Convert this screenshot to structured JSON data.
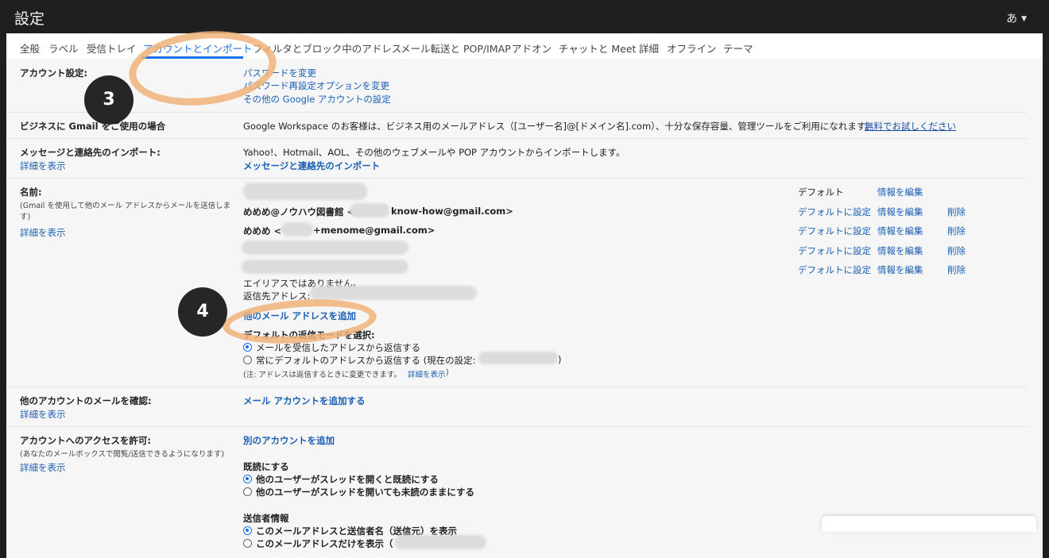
{
  "window": {
    "title": "設定",
    "ime_indicator": "あ"
  },
  "tabs": [
    {
      "label": "全般"
    },
    {
      "label": "ラベル"
    },
    {
      "label": "受信トレイ"
    },
    {
      "label": "アカウントとインポート",
      "active": true
    },
    {
      "label": "フィルタとブロック中のアドレス"
    },
    {
      "label": "メール転送と POP/IMAP"
    },
    {
      "label": "アドオン"
    },
    {
      "label": "チャットと Meet"
    },
    {
      "label": "詳細"
    },
    {
      "label": "オフライン"
    },
    {
      "label": "テーマ"
    }
  ],
  "account_settings": {
    "label": "アカウント設定:",
    "links": [
      "パスワードを変更",
      "パスワード再設定オプションを変更",
      "その他の Google アカウントの設定"
    ]
  },
  "business": {
    "label": "ビジネスに Gmail をご使用の場合",
    "text": "Google Workspace のお客様は、ビジネス用のメールアドレス（[ユーザー名]@[ドメイン名].com）、十分な保存容量、管理ツールをご利用になれます。",
    "link": "無料でお試しください"
  },
  "import": {
    "label": "メッセージと連絡先のインポート:",
    "details": "詳細を表示",
    "text": "Yahoo!、Hotmail、AOL、その他のウェブメールや POP アカウントからインポートします。",
    "link": "メッセージと連絡先のインポート"
  },
  "name": {
    "label": "名前:",
    "sub": "(Gmail を使用して他のメール アドレスからメールを送信しま",
    "sub2": "す)",
    "details": "詳細を表示",
    "accounts": [
      {
        "address": "",
        "status": "デフォルト",
        "edit": "情報を編集",
        "delete": ""
      },
      {
        "address": "めめめ@ノウハウ図書館 <",
        "address_tail": "know-how@gmail.com>",
        "status": "デフォルトに設定",
        "edit": "情報を編集",
        "delete": "削除"
      },
      {
        "address": "めめめ <",
        "address_tail": "+menome@gmail.com>",
        "status": "デフォルトに設定",
        "edit": "情報を編集",
        "delete": "削除"
      },
      {
        "address": "",
        "status": "デフォルトに設定",
        "edit": "情報を編集",
        "delete": "削除"
      },
      {
        "address": "",
        "status": "デフォルトに設定",
        "edit": "情報を編集",
        "delete": "削除"
      }
    ],
    "alias": "エイリアスではありません。",
    "reply_to": "返信先アドレス:",
    "add_link": "他のメール アドレスを追加",
    "reply_mode_label": "デフォルトの返信モードを選択:",
    "reply_options": [
      {
        "label": "メールを受信したアドレスから返信する",
        "checked": true
      },
      {
        "label": "常にデフォルトのアドレスから返信する (現在の設定:",
        "suffix": ")",
        "checked": false
      }
    ],
    "note": "(注: アドレスは返信するときに変更できます。",
    "note_link": "詳細を表示",
    "note_end": ")"
  },
  "check_mail": {
    "label": "他のアカウントのメールを確認:",
    "details": "詳細を表示",
    "link": "メール アカウントを追加する"
  },
  "access": {
    "label": "アカウントへのアクセスを許可:",
    "sub": "(あなたのメールボックスで閲覧/送信できるようになります)",
    "details": "詳細を表示",
    "link": "別のアカウントを追加",
    "mark_read_label": "既読にする",
    "mark_read_options": [
      {
        "label": "他のユーザーがスレッドを開くと既読にする",
        "checked": true
      },
      {
        "label": "他のユーザーがスレッドを開いても未読のままにする",
        "checked": false
      }
    ],
    "sender_label": "送信者情報",
    "sender_options": [
      {
        "label": "このメールアドレスと送信者名（送信元）を表示",
        "checked": true
      },
      {
        "label": "このメールアドレスだけを表示（",
        "checked": false
      }
    ]
  },
  "annotations": {
    "marker_3": "3",
    "marker_4": "4",
    "highlight_color": "#f1b37a"
  },
  "colors": {
    "link": "#1a5fb4",
    "accent": "#1a73e8",
    "titlebar": "#1f1f1f"
  }
}
